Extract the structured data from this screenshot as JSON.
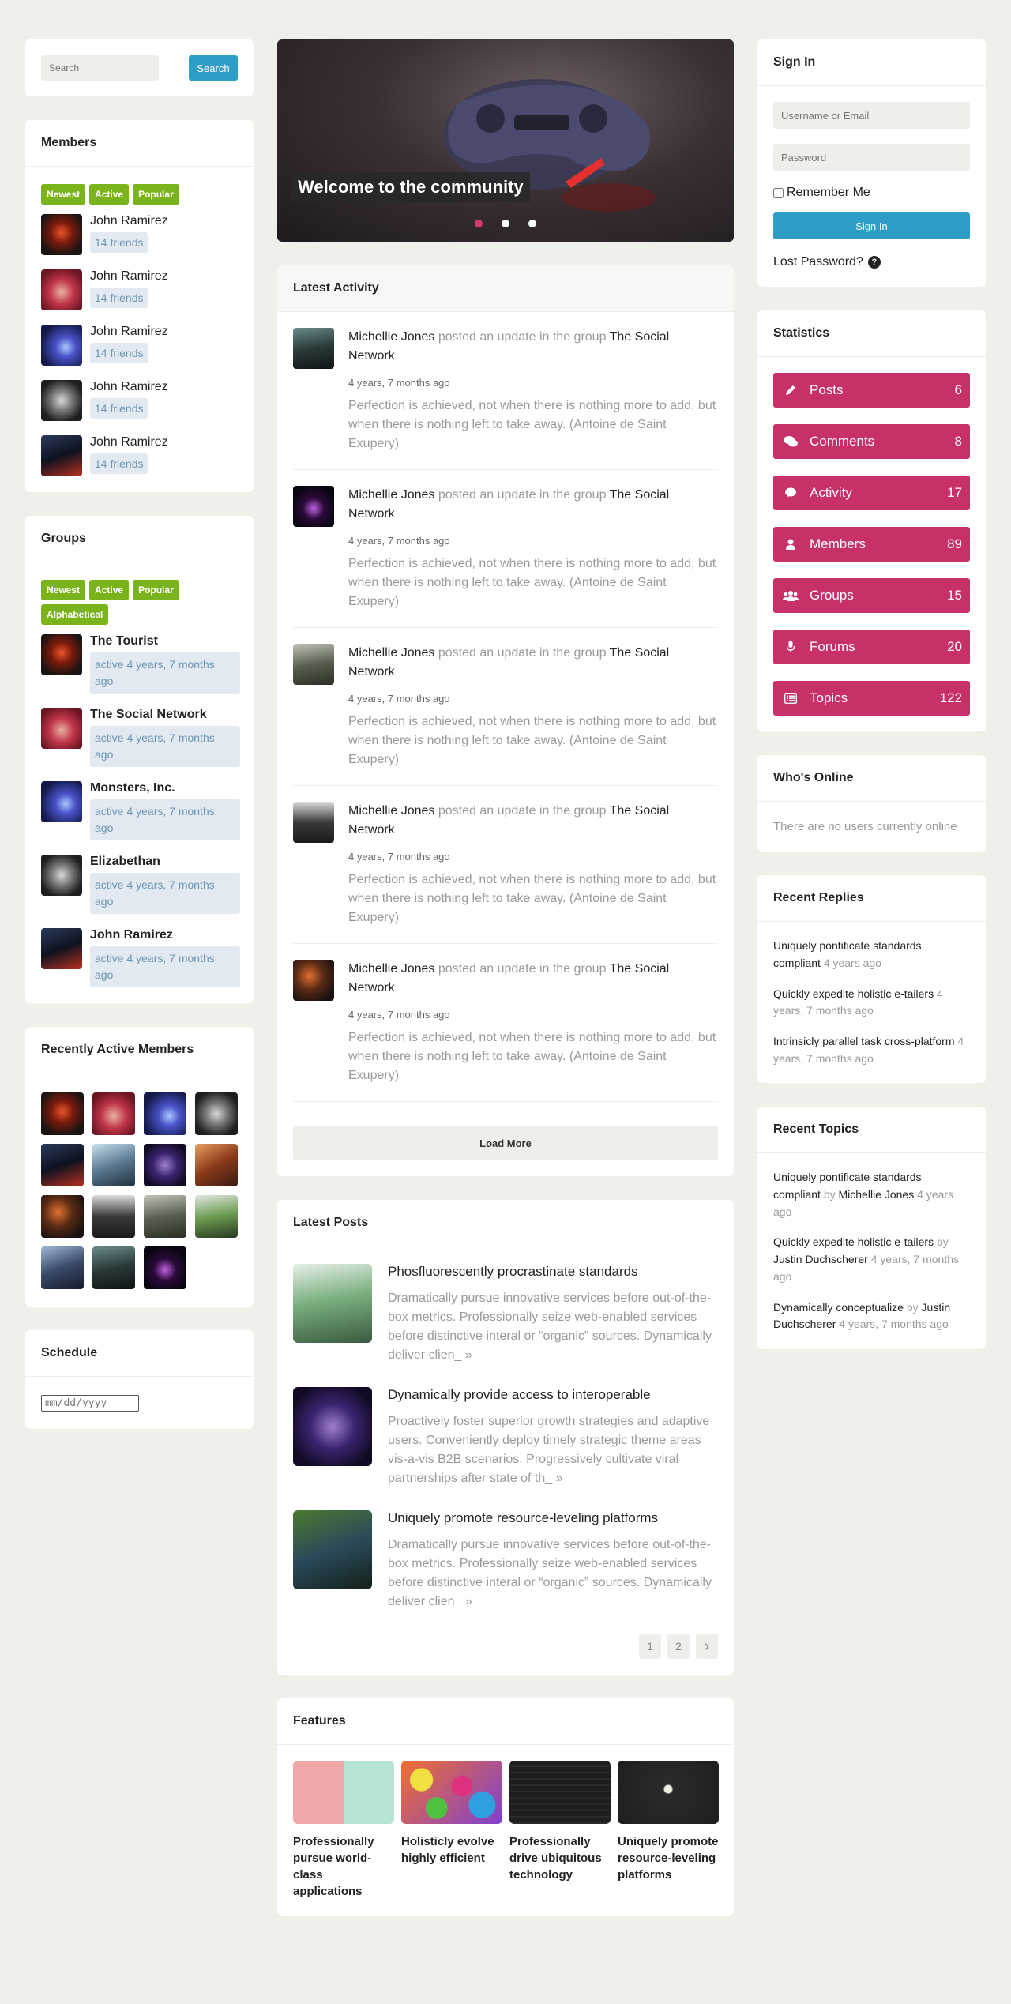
{
  "search": {
    "placeholder": "Search",
    "button": "Search"
  },
  "members": {
    "title": "Members",
    "tabs": [
      "Newest",
      "Active",
      "Popular"
    ],
    "items": [
      {
        "name": "John Ramirez",
        "friends": "14 friends"
      },
      {
        "name": "John Ramirez",
        "friends": "14 friends"
      },
      {
        "name": "John Ramirez",
        "friends": "14 friends"
      },
      {
        "name": "John Ramirez",
        "friends": "14 friends"
      },
      {
        "name": "John Ramirez",
        "friends": "14 friends"
      }
    ]
  },
  "groups": {
    "title": "Groups",
    "tabs": [
      "Newest",
      "Active",
      "Popular",
      "Alphabetical"
    ],
    "items": [
      {
        "name": "The Tourist",
        "active": "active 4 years, 7 months ago"
      },
      {
        "name": "The Social Network",
        "active": "active 4 years, 7 months ago"
      },
      {
        "name": "Monsters, Inc.",
        "active": "active 4 years, 7 months ago"
      },
      {
        "name": "Elizabethan",
        "active": "active 4 years, 7 months ago"
      },
      {
        "name": "John Ramirez",
        "active": "active 4 years, 7 months ago"
      }
    ]
  },
  "recent_members": {
    "title": "Recently Active Members"
  },
  "schedule": {
    "title": "Schedule",
    "date_placeholder": "mm/dd/yyyy"
  },
  "hero": {
    "caption": "Welcome to the community"
  },
  "activity": {
    "title": "Latest Activity",
    "items": [
      {
        "user": "Michellie Jones",
        "action": "posted an update in the group",
        "group": "The Social Network",
        "time": "4 years, 7 months ago",
        "text": "Perfection is achieved, not when there is nothing more to add, but when there is nothing left to take away. (Antoine de Saint Exupery)"
      },
      {
        "user": "Michellie Jones",
        "action": "posted an update in the group",
        "group": "The Social Network",
        "time": "4 years, 7 months ago",
        "text": "Perfection is achieved, not when there is nothing more to add, but when there is nothing left to take away. (Antoine de Saint Exupery)"
      },
      {
        "user": "Michellie Jones",
        "action": "posted an update in the group",
        "group": "The Social Network",
        "time": "4 years, 7 months ago",
        "text": "Perfection is achieved, not when there is nothing more to add, but when there is nothing left to take away. (Antoine de Saint Exupery)"
      },
      {
        "user": "Michellie Jones",
        "action": "posted an update in the group",
        "group": "The Social Network",
        "time": "4 years, 7 months ago",
        "text": "Perfection is achieved, not when there is nothing more to add, but when there is nothing left to take away. (Antoine de Saint Exupery)"
      },
      {
        "user": "Michellie Jones",
        "action": "posted an update in the group",
        "group": "The Social Network",
        "time": "4 years, 7 months ago",
        "text": "Perfection is achieved, not when there is nothing more to add, but when there is nothing left to take away. (Antoine de Saint Exupery)"
      }
    ],
    "load_more": "Load More"
  },
  "posts": {
    "title": "Latest Posts",
    "items": [
      {
        "title": "Phosfluorescently procrastinate standards",
        "text": "Dramatically pursue innovative services before out-of-the-box metrics. Professionally seize web-enabled services before distinctive interal or “organic” sources. Dynamically deliver clien_ »"
      },
      {
        "title": "Dynamically provide access to interoperable",
        "text": "Proactively foster superior growth strategies and adaptive users. Conveniently deploy timely strategic theme areas vis-a-vis B2B scenarios. Progressively cultivate viral partnerships after state of th_ »"
      },
      {
        "title": "Uniquely promote resource-leveling platforms",
        "text": "Dramatically pursue innovative services before out-of-the-box metrics. Professionally seize web-enabled services before distinctive interal or “organic” sources. Dynamically deliver clien_ »"
      }
    ],
    "pages": [
      "1",
      "2",
      "›"
    ]
  },
  "features": {
    "title": "Features",
    "items": [
      {
        "title": "Professionally pursue world-class applications"
      },
      {
        "title": "Holisticly evolve highly efficient"
      },
      {
        "title": "Professionally drive ubiquitous technology"
      },
      {
        "title": "Uniquely promote resource-leveling platforms"
      }
    ]
  },
  "signin": {
    "title": "Sign In",
    "username_placeholder": "Username or Email",
    "password_placeholder": "Password",
    "remember": "Remember Me",
    "button": "Sign In",
    "lost": "Lost Password?"
  },
  "statistics": {
    "title": "Statistics",
    "items": [
      {
        "label": "Posts",
        "count": "6",
        "icon": "pencil-icon"
      },
      {
        "label": "Comments",
        "count": "8",
        "icon": "comments-icon"
      },
      {
        "label": "Activity",
        "count": "17",
        "icon": "chat-bubble-icon"
      },
      {
        "label": "Members",
        "count": "89",
        "icon": "user-icon"
      },
      {
        "label": "Groups",
        "count": "15",
        "icon": "users-icon"
      },
      {
        "label": "Forums",
        "count": "20",
        "icon": "microphone-icon"
      },
      {
        "label": "Topics",
        "count": "122",
        "icon": "list-icon"
      }
    ],
    "color": "#c8306a"
  },
  "whos_online": {
    "title": "Who's Online",
    "text": "There are no users currently online"
  },
  "recent_replies": {
    "title": "Recent Replies",
    "items": [
      {
        "title": "Uniquely pontificate standards compliant",
        "time": "4 years ago"
      },
      {
        "title": "Quickly expedite holistic e-tailers",
        "time": "4 years, 7 months ago"
      },
      {
        "title": "Intrinsicly parallel task cross-platform",
        "time": "4 years, 7 months ago"
      }
    ]
  },
  "recent_topics": {
    "title": "Recent Topics",
    "by": "by",
    "items": [
      {
        "title": "Uniquely pontificate standards compliant",
        "author": "Michellie Jones",
        "time": "4 years ago"
      },
      {
        "title": "Quickly expedite holistic e-tailers",
        "author": "Justin Duchscherer",
        "time": "4 years, 7 months ago"
      },
      {
        "title": "Dynamically conceptualize",
        "author": "Justin Duchscherer",
        "time": "4 years, 7 months ago"
      }
    ]
  },
  "colors": {
    "accent_blue": "#2e9dc8",
    "tag_green": "#7ab31c",
    "stat_pink": "#c8306a",
    "background": "#f0f0eb"
  }
}
